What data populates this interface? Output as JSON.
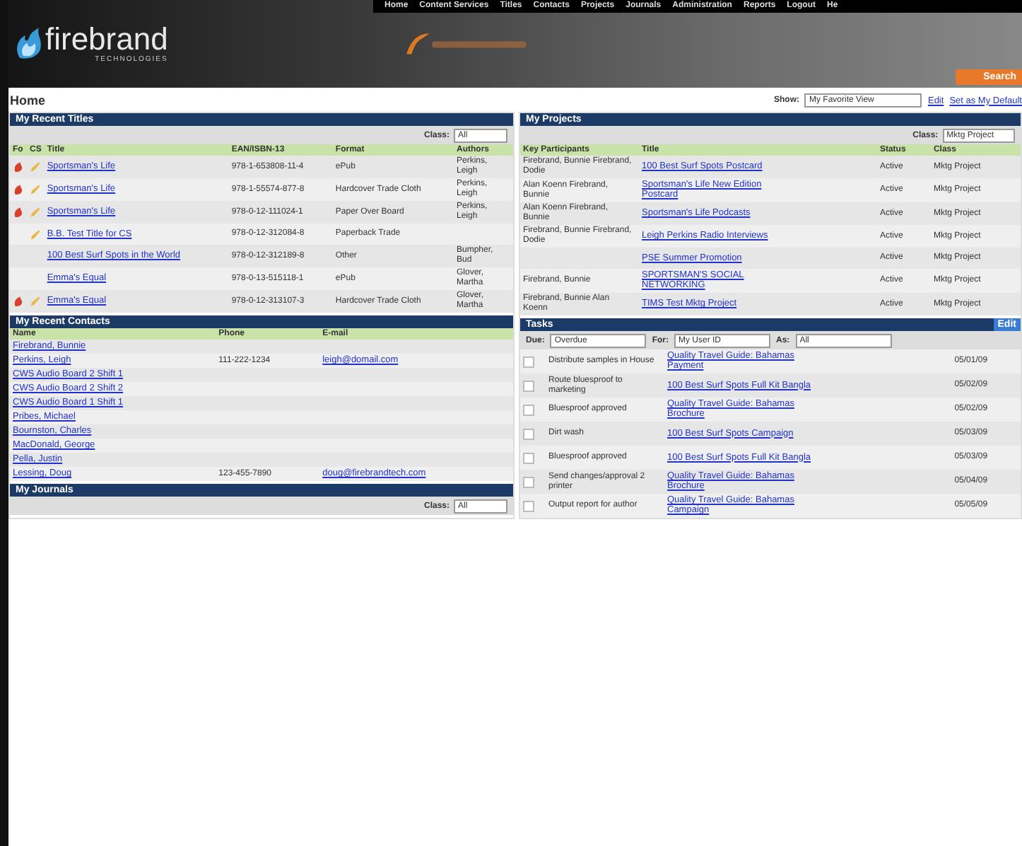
{
  "header": {
    "logo": "firebrand",
    "logo_sub": "TECHNOLOGIES",
    "nav": [
      "Home",
      "Content Services",
      "Titles",
      "Contacts",
      "Projects",
      "Journals",
      "Administration",
      "Reports",
      "Logout",
      "He"
    ],
    "search_button": "Search"
  },
  "page": {
    "title": "Home",
    "show_label": "Show:",
    "show_value": "My Favorite View",
    "links": [
      "Edit",
      "Set as My Default"
    ]
  },
  "recent_titles": {
    "title": "My Recent Titles",
    "class_label": "Class:",
    "class_value": "All",
    "columns": [
      "Fo",
      "CS",
      "Title",
      "EAN/ISBN-13",
      "Format",
      "Authors"
    ],
    "rows": [
      {
        "fo": true,
        "cs": true,
        "title": "Sportsman's Life",
        "ean": "978-1-653808-11-4",
        "format": "ePub",
        "authors": "Perkins, Leigh"
      },
      {
        "fo": true,
        "cs": true,
        "title": "Sportsman's Life",
        "ean": "978-1-55574-877-8",
        "format": "Hardcover Trade Cloth",
        "authors": "Perkins, Leigh"
      },
      {
        "fo": true,
        "cs": true,
        "title": "Sportsman's Life",
        "ean": "978-0-12-111024-1",
        "format": "Paper Over Board",
        "authors": "Perkins, Leigh"
      },
      {
        "fo": false,
        "cs": true,
        "title": "B.B. Test Title for CS",
        "ean": "978-0-12-312084-8",
        "format": "Paperback Trade",
        "authors": ""
      },
      {
        "fo": false,
        "cs": false,
        "title": "100 Best Surf Spots in the World",
        "ean": "978-0-12-312189-8",
        "format": "Other",
        "authors": "Bumpher, Bud"
      },
      {
        "fo": false,
        "cs": false,
        "title": "Emma's Equal",
        "ean": "978-0-13-515118-1",
        "format": "ePub",
        "authors": "Glover, Martha"
      },
      {
        "fo": true,
        "cs": true,
        "title": "Emma's Equal",
        "ean": "978-0-12-313107-3",
        "format": "Hardcover Trade Cloth",
        "authors": "Glover, Martha"
      }
    ]
  },
  "projects": {
    "title": "My Projects",
    "class_label": "Class:",
    "class_value": "Mktg Project",
    "columns": [
      "Key Participants",
      "Title",
      "Status",
      "Class"
    ],
    "rows": [
      {
        "participants": "Firebrand, Bunnie Firebrand, Dodie",
        "title": "100 Best Surf Spots Postcard",
        "status": "Active",
        "class": "Mktg Project"
      },
      {
        "participants": "Alan Koenn Firebrand, Bunnie",
        "title": "Sportsman's Life New Edition Postcard",
        "status": "Active",
        "class": "Mktg Project"
      },
      {
        "participants": "Alan Koenn Firebrand, Bunnie",
        "title": "Sportsman's Life Podcasts",
        "status": "Active",
        "class": "Mktg Project"
      },
      {
        "participants": "Firebrand, Bunnie Firebrand, Dodie",
        "title": "Leigh Perkins Radio Interviews",
        "status": "Active",
        "class": "Mktg Project"
      },
      {
        "participants": "",
        "title": "PSE Summer Promotion",
        "status": "Active",
        "class": "Mktg Project"
      },
      {
        "participants": "Firebrand, Bunnie",
        "title": "SPORTSMAN'S SOCIAL NETWORKING",
        "status": "Active",
        "class": "Mktg Project"
      },
      {
        "participants": "Firebrand, Bunnie Alan Koenn",
        "title": "TIMS Test Mktg Project",
        "status": "Active",
        "class": "Mktg Project"
      }
    ]
  },
  "contacts": {
    "title": "My Recent Contacts",
    "columns": [
      "Name",
      "Phone",
      "E-mail"
    ],
    "rows": [
      {
        "name": "Firebrand, Bunnie",
        "phone": "",
        "email": ""
      },
      {
        "name": "Perkins, Leigh",
        "phone": "111-222-1234",
        "email": "leigh@domail.com"
      },
      {
        "name": "CWS Audio Board 2 Shift 1",
        "phone": "",
        "email": ""
      },
      {
        "name": "CWS Audio Board 2 Shift 2",
        "phone": "",
        "email": ""
      },
      {
        "name": "CWS Audio Board 1 Shift 1",
        "phone": "",
        "email": ""
      },
      {
        "name": "Pribes, Michael",
        "phone": "",
        "email": ""
      },
      {
        "name": "Bournston, Charles",
        "phone": "",
        "email": ""
      },
      {
        "name": "MacDonald, George",
        "phone": "",
        "email": ""
      },
      {
        "name": "Pella, Justin",
        "phone": "",
        "email": ""
      },
      {
        "name": "Lessing, Doug",
        "phone": "123-455-7890",
        "email": "doug@firebrandtech.com"
      }
    ]
  },
  "journals": {
    "title": "My Journals",
    "class_label": "Class:",
    "class_value": "All"
  },
  "tasks": {
    "title": "Tasks",
    "edit": "Edit",
    "filters": [
      {
        "label": "Due:",
        "value": "Overdue"
      },
      {
        "label": "For:",
        "value": "My User ID"
      },
      {
        "label": "As:",
        "value": "All"
      }
    ],
    "rows": [
      {
        "checked": false,
        "task": "Distribute samples in House",
        "title": "Quality Travel Guide: Bahamas Payment",
        "date": "05/01/09"
      },
      {
        "checked": false,
        "task": "Route bluesproof to marketing",
        "title": "100 Best Surf Spots Full Kit Bangla",
        "date": "05/02/09"
      },
      {
        "checked": false,
        "task": "Bluesproof approved",
        "title": "Quality Travel Guide: Bahamas Brochure",
        "date": "05/02/09"
      },
      {
        "checked": false,
        "task": "Dirt wash",
        "title": "100 Best Surf Spots Campaign",
        "date": "05/03/09"
      },
      {
        "checked": false,
        "task": "Bluesproof approved",
        "title": "100 Best Surf Spots Full Kit Bangla",
        "date": "05/03/09"
      },
      {
        "checked": false,
        "task": "Send changes/approval 2 printer",
        "title": "Quality Travel Guide: Bahamas Brochure",
        "date": "05/04/09"
      },
      {
        "checked": false,
        "task": "Output report for author",
        "title": "Quality Travel Guide: Bahamas Campaign",
        "date": "05/05/09"
      }
    ]
  }
}
